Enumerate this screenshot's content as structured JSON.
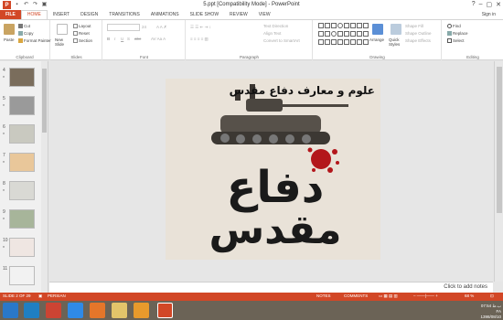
{
  "window": {
    "title": "5.ppt [Compatibility Mode] - PowerPoint",
    "sign_in": "Sign in",
    "controls": [
      "?",
      "–",
      "▢",
      "✕"
    ]
  },
  "tabs": [
    "FILE",
    "HOME",
    "INSERT",
    "DESIGN",
    "TRANSITIONS",
    "ANIMATIONS",
    "SLIDE SHOW",
    "REVIEW",
    "VIEW"
  ],
  "active_tab": "HOME",
  "ribbon": {
    "clipboard": {
      "paste": "Paste",
      "cut": "Cut",
      "copy": "Copy",
      "format_painter": "Format Painter",
      "label": "Clipboard"
    },
    "slides": {
      "new_slide": "New Slide",
      "layout": "Layout",
      "reset": "Reset",
      "section": "Section",
      "label": "Slides"
    },
    "font": {
      "font_size": "24",
      "bold": "B",
      "italic": "I",
      "underline": "U",
      "strike": "S",
      "abc": "abc",
      "label": "Font"
    },
    "paragraph": {
      "text_direction": "Text Direction",
      "align_text": "Align Text",
      "convert_smartart": "Convert to SmartArt",
      "label": "Paragraph"
    },
    "drawing": {
      "arrange": "Arrange",
      "quick_styles": "Quick Styles",
      "shape_fill": "Shape Fill",
      "shape_outline": "Shape Outline",
      "shape_effects": "Shape Effects",
      "label": "Drawing"
    },
    "editing": {
      "find": "Find",
      "replace": "Replace",
      "select": "Select",
      "label": "Editing"
    }
  },
  "thumbnails": [
    {
      "num": "4",
      "star": "*"
    },
    {
      "num": "5",
      "star": "*"
    },
    {
      "num": "6",
      "star": "*"
    },
    {
      "num": "7",
      "star": "*"
    },
    {
      "num": "8",
      "star": "*"
    },
    {
      "num": "9",
      "star": "*"
    },
    {
      "num": "10",
      "star": "*"
    },
    {
      "num": "11",
      "star": ""
    }
  ],
  "slide": {
    "title": "علوم و معارف دفاع مقدس",
    "calligraphy_top": "دفاع",
    "calligraphy_bottom": "مقدس"
  },
  "notes_placeholder": "Click to add notes",
  "status": {
    "slide_counter": "SLIDE 2 OF 29",
    "language": "PERSIAN",
    "notes": "NOTES",
    "comments": "COMMENTS",
    "zoom": "68 %"
  },
  "tray": {
    "time": "07:54 ب.ظ",
    "lang": "FA",
    "date": "1398/08/10"
  }
}
